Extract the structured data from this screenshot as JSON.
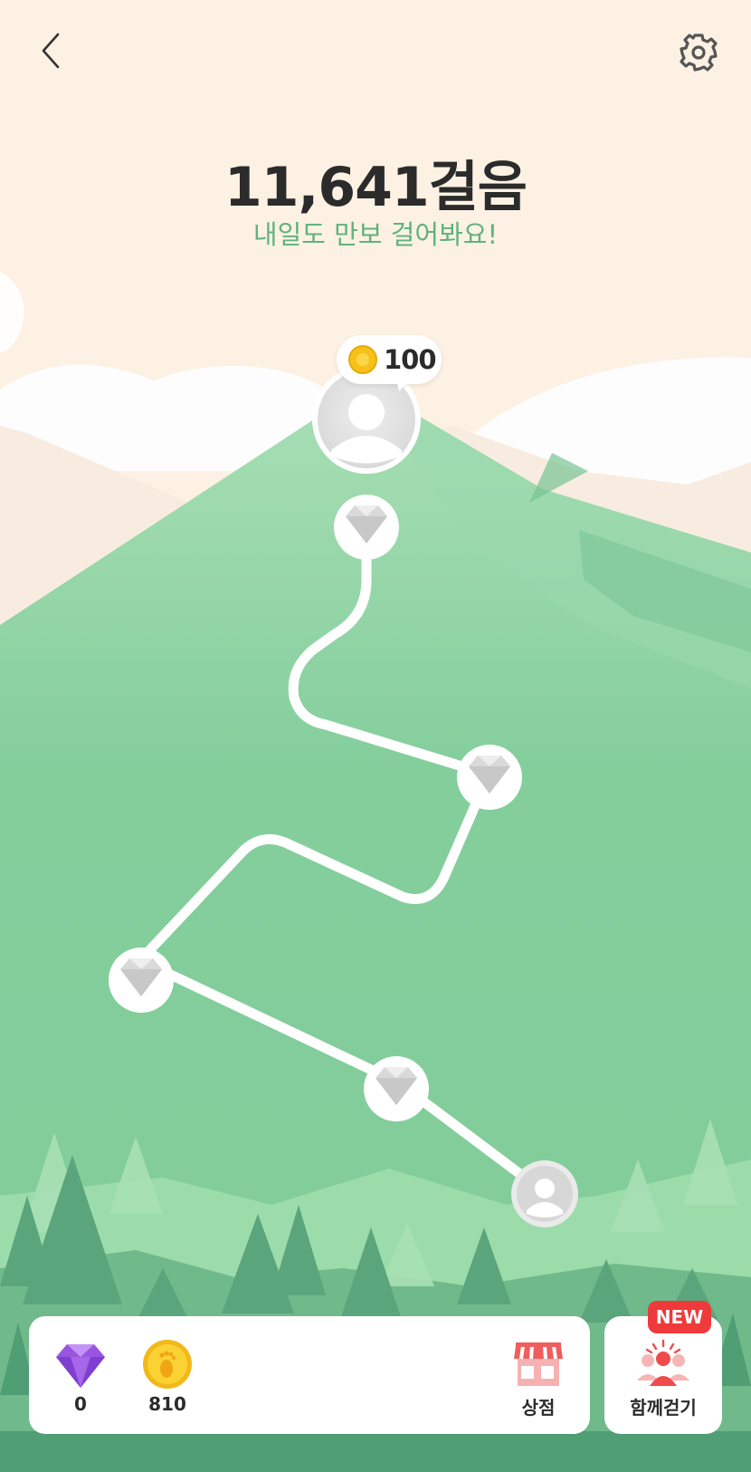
{
  "header": {
    "back_icon": "chevron-left-icon",
    "settings_icon": "gear-icon"
  },
  "summary": {
    "steps_text": "11,641걸음",
    "subtitle": "내일도 만보 걸어봐요!"
  },
  "reward_bubble": {
    "icon": "coin-icon",
    "value": "100"
  },
  "map": {
    "milestones": [
      {
        "type": "avatar",
        "state": "top"
      },
      {
        "type": "gem",
        "state": "locked"
      },
      {
        "type": "gem",
        "state": "locked"
      },
      {
        "type": "gem",
        "state": "locked"
      },
      {
        "type": "gem",
        "state": "locked"
      },
      {
        "type": "avatar",
        "state": "start"
      }
    ]
  },
  "bottom_bar": {
    "gems": {
      "icon": "purple-diamond-icon",
      "count": "0"
    },
    "coins": {
      "icon": "footprint-coin-icon",
      "count": "810"
    },
    "shop": {
      "icon": "store-icon",
      "label": "상점"
    },
    "together": {
      "icon": "people-icon",
      "label": "함께걷기",
      "badge": "NEW"
    }
  },
  "colors": {
    "sky": "#fcf1e2",
    "mountain": "#82cd9b",
    "trail": "#ffffff",
    "subtitle": "#5fb27f",
    "badge": "#ee3a3a",
    "coin": "#f6c21a",
    "gem": "#9a55e0"
  }
}
